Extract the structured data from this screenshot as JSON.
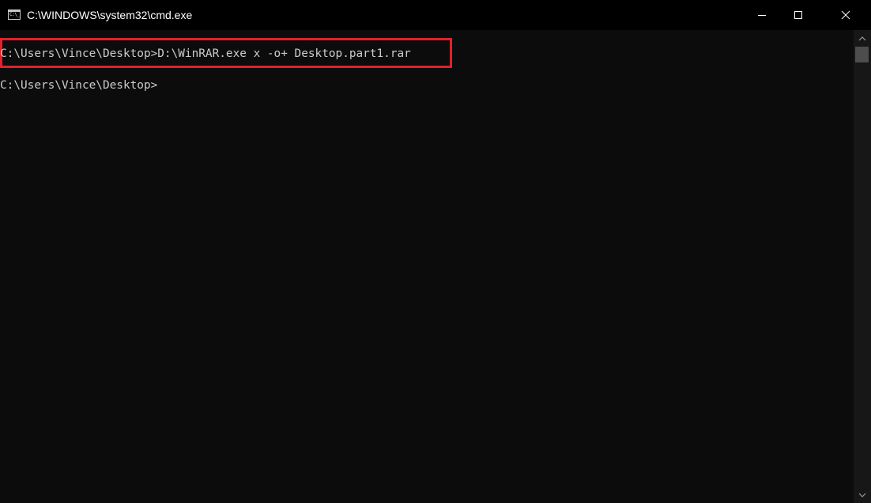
{
  "window": {
    "title": "C:\\WINDOWS\\system32\\cmd.exe",
    "icon": "cmd-icon",
    "icon_label": "C:\\_"
  },
  "controls": {
    "minimize_icon": "minimize-icon",
    "maximize_icon": "maximize-icon",
    "close_icon": "close-icon"
  },
  "terminal": {
    "lines": [
      "C:\\Users\\Vince\\Desktop>D:\\WinRAR.exe x -o+ Desktop.part1.rar",
      "C:\\Users\\Vince\\Desktop>"
    ],
    "text_color": "#cccccc",
    "background_color": "#0c0c0c"
  },
  "annotation": {
    "highlight_color": "#e3202c"
  }
}
